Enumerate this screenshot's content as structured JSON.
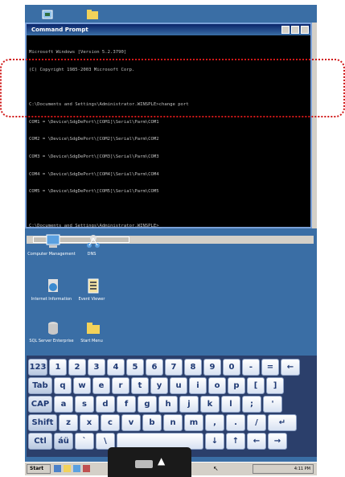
{
  "window": {
    "title": "Command Prompt",
    "lines": [
      "Microsoft Windows [Version 5.2.3790]",
      "(C) Copyright 1985-2003 Microsoft Corp.",
      "",
      "C:\\Documents and Settings\\Administrator.WINSPLE>change port",
      "COM1 = \\Device\\SdgDePort\\[COM1]\\Serial\\Parm\\COM1",
      "COM2 = \\Device\\SdgDePort\\[COM2]\\Serial\\Parm\\COM2",
      "COM3 = \\Device\\SdgDePort\\[COM3]\\Serial\\Parm\\COM3",
      "COM4 = \\Device\\SdgDePort\\[COM4]\\Serial\\Parm\\COM4",
      "COM5 = \\Device\\SdgDePort\\[COM5]\\Serial\\Parm\\COM5",
      "",
      "C:\\Documents and Settings\\Administrator.WINSPLE>_"
    ]
  },
  "desktop": {
    "icons": [
      {
        "label": "Computer Management",
        "icon": "computer-icon"
      },
      {
        "label": "DNS",
        "icon": "network-icon"
      },
      {
        "label": "Internet Information",
        "icon": "globe-icon"
      },
      {
        "label": "Event Viewer",
        "icon": "log-icon"
      },
      {
        "label": "SQL Server Enterprise",
        "icon": "database-icon"
      },
      {
        "label": "Start Menu",
        "icon": "folder-icon"
      }
    ]
  },
  "keyboard": {
    "rows": [
      [
        "123",
        "1",
        "2",
        "3",
        "4",
        "5",
        "6",
        "7",
        "8",
        "9",
        "0",
        "-",
        "=",
        "←"
      ],
      [
        "Tab",
        "q",
        "w",
        "e",
        "r",
        "t",
        "y",
        "u",
        "i",
        "o",
        "p",
        "[",
        "]"
      ],
      [
        "CAP",
        "a",
        "s",
        "d",
        "f",
        "g",
        "h",
        "j",
        "k",
        "l",
        ";",
        "'"
      ],
      [
        "Shift",
        "z",
        "x",
        "c",
        "v",
        "b",
        "n",
        "m",
        ",",
        ".",
        "/",
        "↵"
      ],
      [
        "Ctl",
        "áü",
        "`",
        "\\",
        "",
        "↓",
        "↑",
        "←",
        "→"
      ]
    ]
  },
  "taskbar": {
    "start_label": "Start",
    "clock": "4:11 PM"
  },
  "colors": {
    "desktop": "#3a6ea5",
    "annotation": "#d01818"
  }
}
